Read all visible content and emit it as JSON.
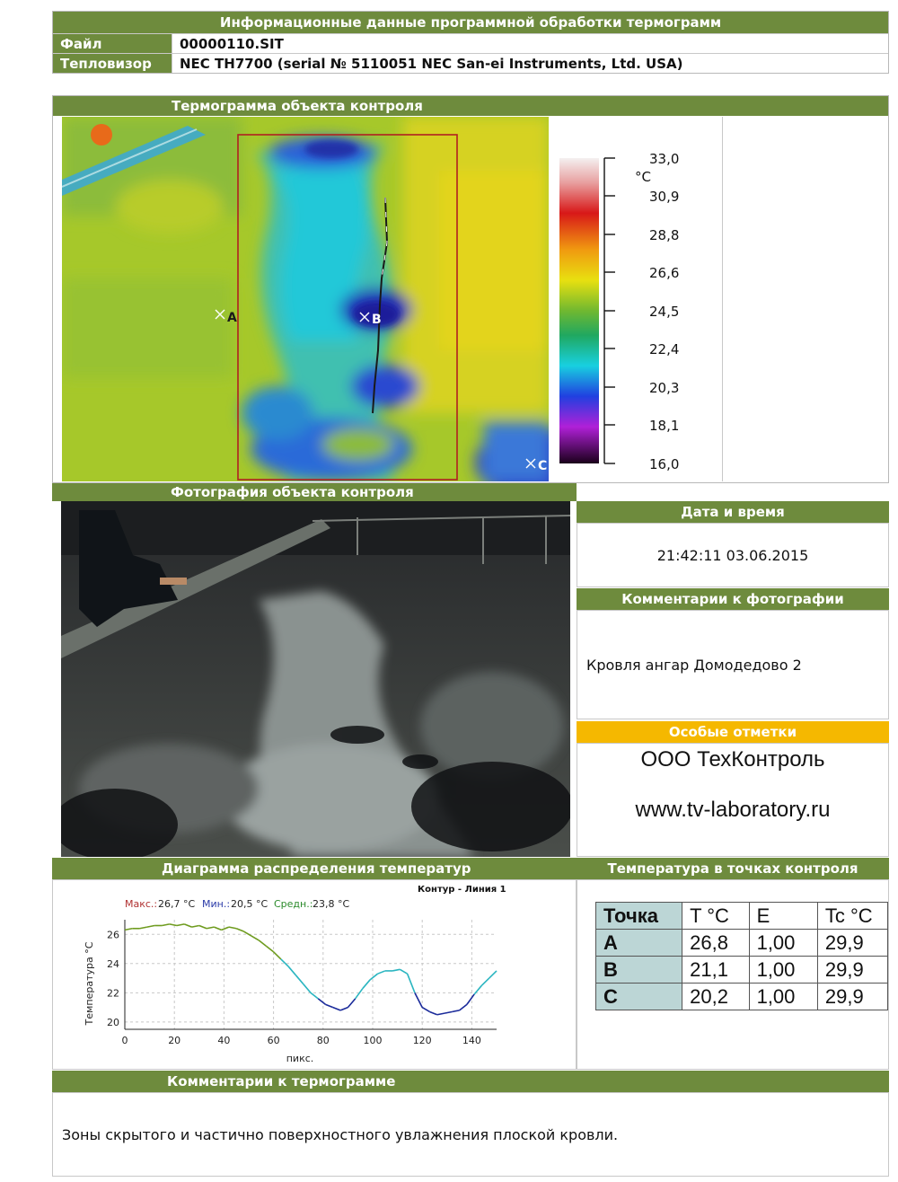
{
  "header": {
    "title": "Информационные данные программной обработки термограмм",
    "file_label": "Файл",
    "file_value": "00000110.SIT",
    "camera_label": "Тепловизор",
    "camera_value": "NEC TH7700 (serial № 5110051 NEC San-ei Instruments, Ltd. USA)"
  },
  "thermogram": {
    "title": "Термограмма объекта контроля",
    "markers": [
      "A",
      "B",
      "C"
    ],
    "scale_unit": "°C",
    "scale_ticks": [
      "33,0",
      "30,9",
      "28,8",
      "26,6",
      "24,5",
      "22,4",
      "20,3",
      "18,1",
      "16,0"
    ]
  },
  "photo": {
    "title": "Фотография объекта контроля"
  },
  "datetime": {
    "title": "Дата и время",
    "value": "21:42:11 03.06.2015"
  },
  "photo_comments": {
    "title": "Комментарии к фотографии",
    "text": "Кровля ангар Домодедово 2"
  },
  "special_notes": {
    "title": "Особые отметки",
    "line1": "ООО ТехКонтроль",
    "line2": "www.tv-laboratory.ru"
  },
  "temp_chart": {
    "section_title": "Диаграмма распределения температур"
  },
  "chart_data": {
    "type": "line",
    "title": "Контур - Линия 1",
    "xlabel": "пикс.",
    "ylabel": "Температура °C",
    "stats": {
      "max_label": "Макс.:",
      "max_value": "26,7 °C",
      "min_label": "Мин.:",
      "min_value": "20,5 °C",
      "avg_label": "Средн.:",
      "avg_value": "23,8 °C"
    },
    "xlim": [
      0,
      150
    ],
    "ylim": [
      19.5,
      27
    ],
    "xticks": [
      0,
      20,
      40,
      60,
      80,
      100,
      120,
      140
    ],
    "yticks": [
      20,
      22,
      24,
      26
    ],
    "x": [
      0,
      3,
      6,
      9,
      12,
      15,
      18,
      21,
      24,
      27,
      30,
      33,
      36,
      39,
      42,
      45,
      48,
      51,
      54,
      57,
      60,
      63,
      66,
      69,
      72,
      75,
      78,
      81,
      84,
      87,
      90,
      93,
      96,
      99,
      102,
      105,
      108,
      111,
      114,
      117,
      120,
      123,
      126,
      129,
      132,
      135,
      138,
      141,
      144,
      147,
      150
    ],
    "y": [
      26.3,
      26.4,
      26.4,
      26.5,
      26.6,
      26.6,
      26.7,
      26.6,
      26.7,
      26.5,
      26.6,
      26.4,
      26.5,
      26.3,
      26.5,
      26.4,
      26.2,
      25.9,
      25.6,
      25.2,
      24.8,
      24.3,
      23.8,
      23.2,
      22.6,
      22.0,
      21.6,
      21.2,
      21.0,
      20.8,
      21.0,
      21.6,
      22.3,
      22.9,
      23.3,
      23.5,
      23.5,
      23.6,
      23.3,
      22.0,
      21.0,
      20.7,
      20.5,
      20.6,
      20.7,
      20.8,
      21.2,
      21.9,
      22.5,
      23.0,
      23.5
    ],
    "color_stops": {
      "above": "#6e9b1e",
      "middle": "#2ab5c0",
      "below": "#1a2a9a"
    },
    "grid": true
  },
  "points": {
    "title": "Температура в точках контроля",
    "headers": [
      "Точка",
      "T °C",
      "E",
      "Tc °C"
    ],
    "rows": [
      [
        "A",
        "26,8",
        "1,00",
        "29,9"
      ],
      [
        "B",
        "21,1",
        "1,00",
        "29,9"
      ],
      [
        "C",
        "20,2",
        "1,00",
        "29,9"
      ]
    ]
  },
  "thermogram_comments": {
    "title": "Комментарии к термограмме",
    "text": "Зоны скрытого и частично поверхностного увлажнения плоской кровли."
  }
}
